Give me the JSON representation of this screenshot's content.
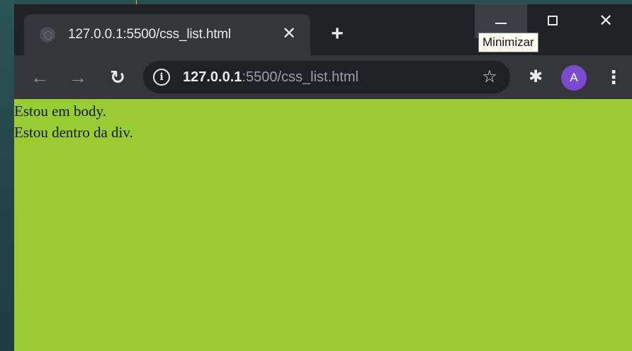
{
  "tab": {
    "title": "127.0.0.1:5500/css_list.html",
    "close_glyph": "✕"
  },
  "new_tab_glyph": "+",
  "window_controls": {
    "minimize_tooltip": "Minimizar",
    "close_glyph": "✕"
  },
  "toolbar": {
    "back_glyph": "←",
    "forward_glyph": "→",
    "reload_glyph": "↻",
    "info_glyph": "i",
    "url_host": "127.0.0.1",
    "url_rest": ":5500/css_list.html",
    "star_glyph": "☆",
    "extensions_glyph": "✱",
    "avatar_letter": "A",
    "menu_glyph": "⋮"
  },
  "page": {
    "body_text": "Estou em body.",
    "div_text": "Estou dentro da div."
  },
  "colors": {
    "page_background": "#99cc32",
    "avatar": "#7a4bd1",
    "tab_active": "#35363a",
    "tabstrip": "#202225"
  },
  "icons": {
    "favicon": "globe-icon",
    "tab_close": "close-icon",
    "new_tab": "plus-icon",
    "minimize": "minimize-icon",
    "maximize": "maximize-icon",
    "close": "close-icon",
    "back": "arrow-left-icon",
    "forward": "arrow-right-icon",
    "reload": "reload-icon",
    "site_info": "info-icon",
    "bookmark": "star-icon",
    "extensions": "puzzle-icon",
    "menu": "kebab-menu-icon"
  }
}
